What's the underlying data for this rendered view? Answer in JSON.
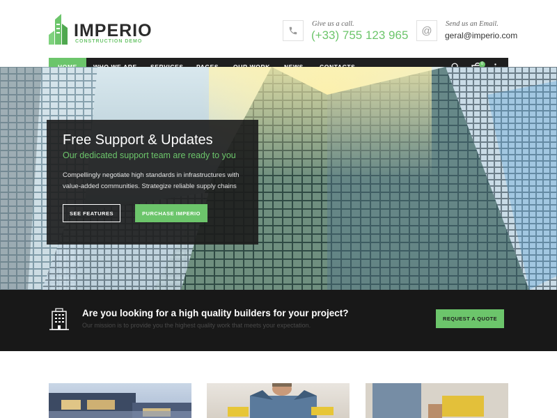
{
  "brand": {
    "name": "IMPERIO",
    "tagline": "CONSTRUCTION DEMO",
    "accent_color": "#6cc56b",
    "dark_color": "#1f1f1f"
  },
  "header": {
    "phone": {
      "icon": "phone-icon",
      "label": "Give us a call.",
      "value": "(+33) 755 123 965"
    },
    "email": {
      "icon": "at-icon",
      "label": "Send us an Email.",
      "value": "geral@imperio.com"
    }
  },
  "nav": {
    "items": [
      {
        "label": "HOME",
        "active": true
      },
      {
        "label": "WHO WE ARE"
      },
      {
        "label": "SERVICES"
      },
      {
        "label": "PAGES"
      },
      {
        "label": "OUR WORK"
      },
      {
        "label": "NEWS"
      },
      {
        "label": "CONTACTS"
      }
    ],
    "cart_count": "0",
    "icons": [
      "search-icon",
      "cart-icon",
      "more-vertical-icon"
    ]
  },
  "hero": {
    "title": "Free Support & Updates",
    "subtitle": "Our dedicated support team are ready to you",
    "text": "Compellingly negotiate high standards in infrastructures with value-added communities. Strategize reliable supply chains",
    "button_primary": "SEE FEATURES",
    "button_secondary": "PURCHASE IMPERIO"
  },
  "cta": {
    "icon": "building-icon",
    "title": "Are you looking for a high quality builders for your project?",
    "subtitle": "Our mission is to provide you the highest quality work that meets your expectation.",
    "button": "REQUEST A QUOTE"
  },
  "thumbnails": [
    "modern-house-image",
    "worker-image",
    "tools-image"
  ]
}
